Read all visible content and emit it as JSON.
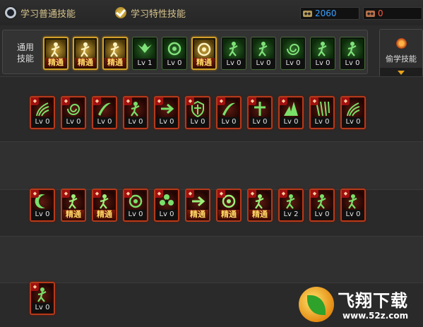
{
  "tabs": [
    {
      "label": "学习普通技能",
      "selected": false
    },
    {
      "label": "学习特性技能",
      "selected": true
    }
  ],
  "currency": [
    {
      "icon": "coin-icon",
      "value": "2060",
      "color": "#3aa0ff"
    },
    {
      "icon": "point-icon",
      "value": "0",
      "color": "#ff5a3a"
    }
  ],
  "common_skills": {
    "label_line1": "通用",
    "label_line2": "技能",
    "items": [
      {
        "name": "skill-1",
        "level": "精通",
        "style": "gold",
        "icon": "figure-sit-icon"
      },
      {
        "name": "skill-2",
        "level": "精通",
        "style": "gold",
        "icon": "figure-crouch-icon"
      },
      {
        "name": "skill-3",
        "level": "精通",
        "style": "gold",
        "icon": "figure-run-icon"
      },
      {
        "name": "skill-4",
        "level": "Lv 1",
        "style": "green",
        "icon": "wings-icon"
      },
      {
        "name": "skill-5",
        "level": "Lv 0",
        "style": "green",
        "icon": "crosshair-icon"
      },
      {
        "name": "skill-6",
        "level": "精通",
        "style": "gold",
        "icon": "crosshair-star-icon"
      },
      {
        "name": "skill-7",
        "level": "Lv 0",
        "style": "green",
        "icon": "figure-bolt-icon"
      },
      {
        "name": "skill-8",
        "level": "Lv 0",
        "style": "green",
        "icon": "figure-gear-icon"
      },
      {
        "name": "skill-9",
        "level": "Lv 0",
        "style": "green",
        "icon": "swirl-icon"
      },
      {
        "name": "skill-10",
        "level": "Lv 0",
        "style": "green",
        "icon": "strong-figure-icon"
      },
      {
        "name": "skill-11",
        "level": "Lv 0",
        "style": "green",
        "icon": "figure-aura-icon"
      }
    ]
  },
  "steal_skill": {
    "label": "偷学技能"
  },
  "row1": [
    {
      "level": "Lv 0",
      "style": "red",
      "icon": "dash-icon"
    },
    {
      "level": "Lv 0",
      "style": "red",
      "icon": "vortex-icon"
    },
    {
      "level": "Lv 0",
      "style": "red",
      "icon": "slash-icon"
    },
    {
      "level": "Lv 0",
      "style": "red",
      "icon": "figure-arms-icon"
    },
    {
      "level": "Lv 0",
      "style": "red",
      "icon": "arrow-burst-icon"
    },
    {
      "level": "Lv 0",
      "style": "red",
      "icon": "shield-icon"
    },
    {
      "level": "Lv 0",
      "style": "red",
      "icon": "claw-icon"
    },
    {
      "level": "Lv 0",
      "style": "red",
      "icon": "cross-icon"
    },
    {
      "level": "Lv 0",
      "style": "red",
      "icon": "spike-icon"
    },
    {
      "level": "Lv 0",
      "style": "red",
      "icon": "rain-icon"
    },
    {
      "level": "Lv 0",
      "style": "red",
      "icon": "wave-icon"
    }
  ],
  "row2": [
    {
      "level": "Lv 0",
      "style": "red",
      "icon": "crescent-icon"
    },
    {
      "level": "精通",
      "style": "redgold",
      "icon": "figure-block-icon"
    },
    {
      "level": "精通",
      "style": "redgold",
      "icon": "figure-glow-icon"
    },
    {
      "level": "Lv 0",
      "style": "red",
      "icon": "ring-glyph-icon"
    },
    {
      "level": "Lv 0",
      "style": "red",
      "icon": "flower-icon"
    },
    {
      "level": "精通",
      "style": "redgold",
      "icon": "arrow-right-icon"
    },
    {
      "level": "精通",
      "style": "redgold",
      "icon": "seal-icon"
    },
    {
      "level": "精通",
      "style": "redgold",
      "icon": "figure-sword-icon"
    },
    {
      "level": "Lv 2",
      "style": "red",
      "icon": "flame-figure-icon"
    },
    {
      "level": "Lv 0",
      "style": "red",
      "icon": "figure-spin-icon"
    },
    {
      "level": "Lv 0",
      "style": "red",
      "icon": "vitruvian-icon"
    }
  ],
  "row3": [
    {
      "level": "Lv 0",
      "style": "red",
      "icon": "figure-run-icon"
    }
  ],
  "watermark": {
    "title": "飞翔下载",
    "url": "www.52z.com"
  }
}
